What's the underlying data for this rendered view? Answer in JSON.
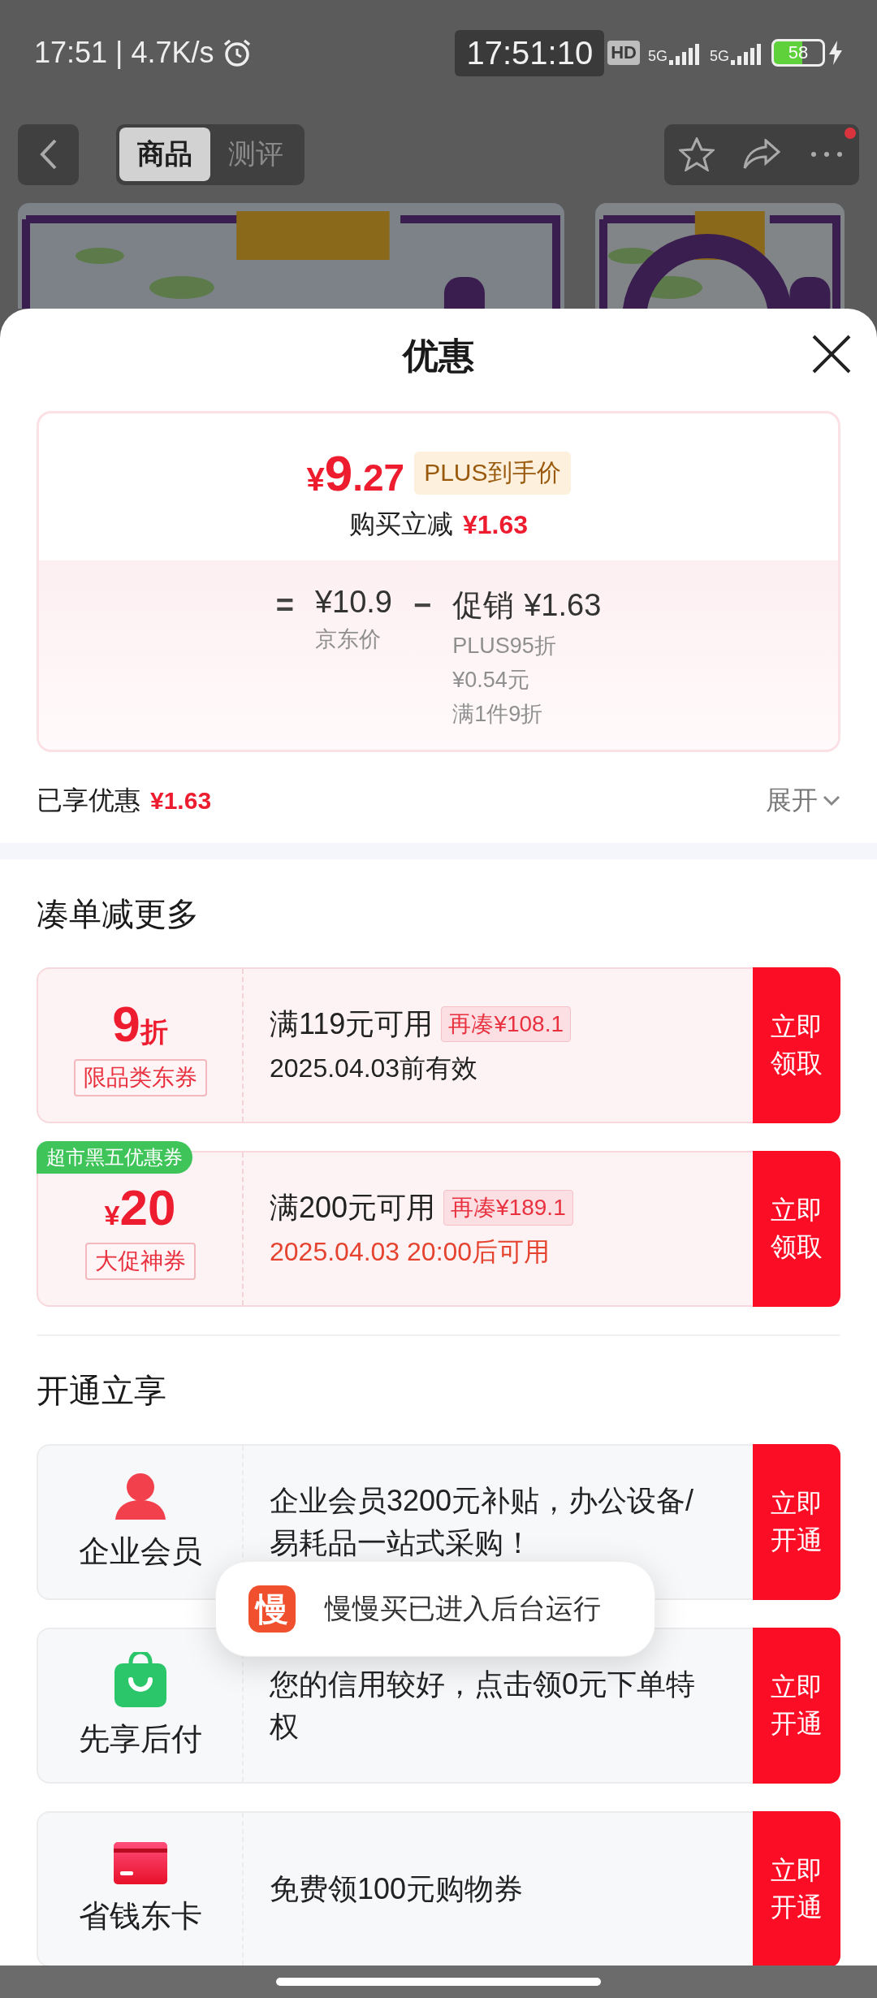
{
  "status_bar": {
    "time": "17:51",
    "separator": "|",
    "net_speed": "4.7K/s",
    "clock_overlay": "17:51:10",
    "hd_badge": "HD",
    "signals": [
      {
        "label": "5G"
      },
      {
        "label": "5G"
      }
    ],
    "battery": "58"
  },
  "nav": {
    "tabs": [
      {
        "label": "商品",
        "selected": true
      },
      {
        "label": "测评",
        "selected": false
      }
    ],
    "more_notification": true
  },
  "sheet": {
    "title": "优惠",
    "price_card": {
      "currency": "¥",
      "integer": "9",
      "decimal": ".27",
      "badge": "PLUS到手价",
      "purchase_label": "购买立减",
      "purchase_amount": "¥1.63",
      "equals": "=",
      "jd_price": "¥10.9",
      "jd_label": "京东价",
      "minus": "−",
      "promo_label": "促销",
      "promo_amount": "¥1.63",
      "promo_details": [
        "PLUS95折",
        "¥0.54元",
        "满1件9折"
      ]
    },
    "savings": {
      "label": "已享优惠",
      "amount": "¥1.63",
      "expand": "展开"
    },
    "coupon_section": {
      "title": "凑单减更多",
      "coupons": [
        {
          "amount": "9",
          "suffix": "折",
          "tag": "限品类东券",
          "condition": "满119元可用",
          "gap": "再凑¥108.1",
          "validity": "2025.04.03前有效",
          "validity_highlight": false,
          "button": "立即领取"
        },
        {
          "prefix": "¥",
          "amount": "20",
          "tag": "大促神券",
          "ribbon": "超市黑五优惠券",
          "condition": "满200元可用",
          "gap": "再凑¥189.1",
          "validity": "2025.04.03 20:00后可用",
          "validity_highlight": true,
          "button": "立即领取"
        }
      ]
    },
    "service_section": {
      "title": "开通立享",
      "services": [
        {
          "kind": "person",
          "name": "企业会员",
          "description": "企业会员3200元补贴，办公设备/易耗品一站式采购！",
          "button": "立即开通"
        },
        {
          "kind": "bag",
          "name": "先享后付",
          "description": "您的信用较好，点击领0元下单特权",
          "button": "立即开通"
        },
        {
          "kind": "card",
          "name": "省钱东卡",
          "description": "免费领100元购物券",
          "button": "立即开通"
        }
      ]
    }
  },
  "toast": {
    "app_glyph": "慢",
    "text": "慢慢买已进入后台运行"
  }
}
